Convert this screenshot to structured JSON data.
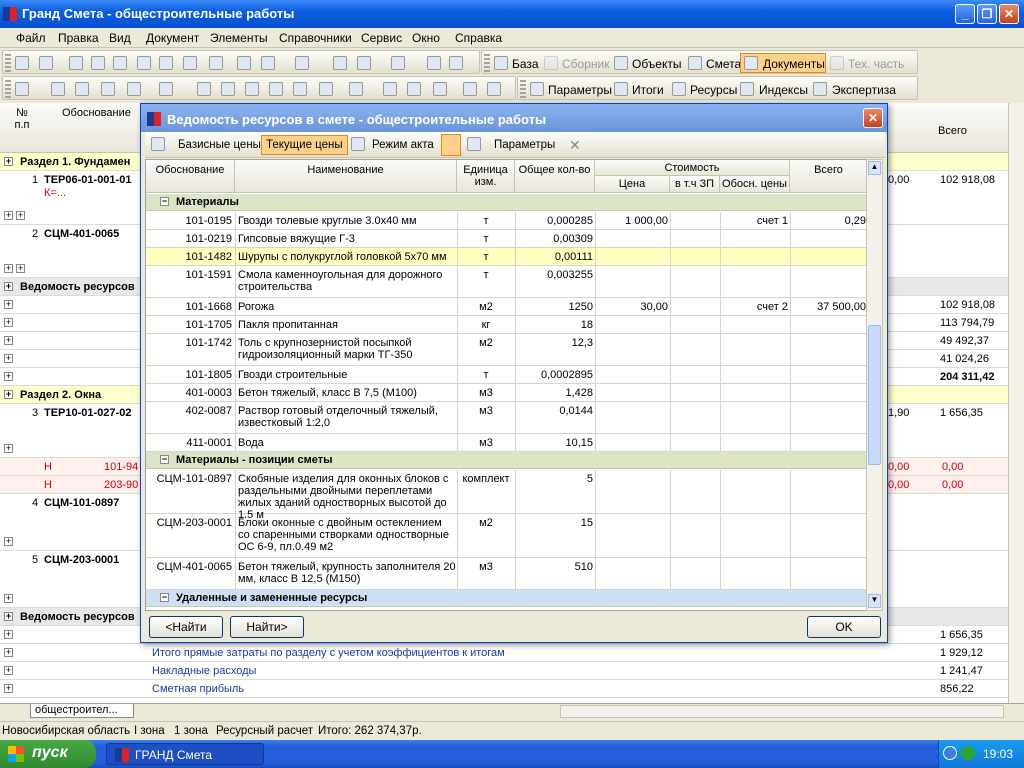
{
  "window": {
    "title": "Гранд Смета - общестроительные работы"
  },
  "menu": [
    "Файл",
    "Правка",
    "Вид",
    "Документ",
    "Элементы",
    "Справочники",
    "Сервис",
    "Окно",
    "Справка"
  ],
  "toolbar1": {
    "items": [
      "База",
      "Сборник",
      "Объекты",
      "Смета",
      "Документы",
      "Тех. часть"
    ]
  },
  "toolbar2": {
    "items": [
      "Параметры",
      "Итоги",
      "Ресурсы",
      "Индексы",
      "Экспертиза"
    ]
  },
  "main": {
    "headers": {
      "num": "№ п.п",
      "basis": "Обоснование",
      "total": "Всего"
    },
    "rows": [
      {
        "kind": "sec",
        "a": "Раздел 1. Фундамен"
      },
      {
        "kind": "item",
        "num": "1",
        "code": "ТЕР06-01-001-01",
        "sub": "К=...",
        "r1": "0,00",
        "total": "102 918,08"
      },
      {
        "kind": "item",
        "num": "2",
        "code": "СЦМ-401-0065"
      },
      {
        "kind": "grey",
        "a": "Ведомость ресурсов"
      },
      {
        "kind": "sum",
        "total": "102 918,08"
      },
      {
        "kind": "sum",
        "total": "113 794,79"
      },
      {
        "kind": "sum",
        "total": "49 492,37"
      },
      {
        "kind": "sum",
        "total": "41 024,26"
      },
      {
        "kind": "sum",
        "total": "204 311,42"
      },
      {
        "kind": "sec",
        "a": "Раздел 2. Окна"
      },
      {
        "kind": "item",
        "num": "3",
        "code": "ТЕР10-01-027-02",
        "r1": "1,90",
        "total": "1 656,35"
      },
      {
        "kind": "h",
        "code": "Н",
        "c2": "101-94",
        "r1": "0,00",
        "total": "0,00"
      },
      {
        "kind": "h",
        "code": "Н",
        "c2": "203-90",
        "r1": "0,00",
        "total": "0,00"
      },
      {
        "kind": "item",
        "num": "4",
        "code": "СЦМ-101-0897"
      },
      {
        "kind": "item",
        "num": "5",
        "code": "СЦМ-203-0001"
      },
      {
        "kind": "grey",
        "a": "Ведомость ресурсов"
      },
      {
        "kind": "sum",
        "total": "1 656,35"
      },
      {
        "kind": "lab",
        "a": "Итого прямые затраты по разделу с учетом коэффициентов к итогам",
        "total": "1 929,12"
      },
      {
        "kind": "lab",
        "a": "Накладные расходы",
        "total": "1 241,47"
      },
      {
        "kind": "lab",
        "a": "Сметная прибыль",
        "total": "856,22"
      }
    ]
  },
  "dialog": {
    "title": "Ведомость ресурсов в смете - общестроительные работы",
    "tb": {
      "base": "Базисные цены",
      "current": "Текущие цены",
      "act": "Режим акта",
      "params": "Параметры"
    },
    "cols": {
      "basis": "Обоснование",
      "name": "Наименование",
      "unit": "Единица изм.",
      "qty": "Общее кол-во",
      "cost": "Стоимость",
      "price": "Цена",
      "zp": "в т.ч ЗП",
      "src": "Обосн. цены",
      "total": "Всего"
    },
    "group1": "Материалы",
    "rows1": [
      {
        "code": "101-0195",
        "name": "Гвозди толевые круглые 3.0х40 мм",
        "unit": "т",
        "qty": "0,000285",
        "price": "1 000,00",
        "src": "счет 1",
        "total": "0,29"
      },
      {
        "code": "101-0219",
        "name": "Гипсовые вяжущие Г-3",
        "unit": "т",
        "qty": "0,00309"
      },
      {
        "code": "101-1482",
        "name": "Шурупы с полукруглой головкой 5х70 мм",
        "unit": "т",
        "qty": "0,00111",
        "sel": true
      },
      {
        "code": "101-1591",
        "name": "Смола каменноугольная для дорожного строительства",
        "unit": "т",
        "qty": "0,003255"
      },
      {
        "code": "101-1668",
        "name": "Рогожа",
        "unit": "м2",
        "qty": "1250",
        "price": "30,00",
        "src": "счет 2",
        "total": "37 500,00"
      },
      {
        "code": "101-1705",
        "name": "Пакля пропитанная",
        "unit": "кг",
        "qty": "18"
      },
      {
        "code": "101-1742",
        "name": "Толь с крупнозернистой посыпкой гидроизоляционный марки ТГ-350",
        "unit": "м2",
        "qty": "12,3"
      },
      {
        "code": "101-1805",
        "name": "Гвозди строительные",
        "unit": "т",
        "qty": "0,0002895"
      },
      {
        "code": "401-0003",
        "name": "Бетон тяжелый, класс В 7,5 (М100)",
        "unit": "м3",
        "qty": "1,428"
      },
      {
        "code": "402-0087",
        "name": "Раствор готовый отделочный тяжелый, известковый 1:2,0",
        "unit": "м3",
        "qty": "0,0144"
      },
      {
        "code": "411-0001",
        "name": "Вода",
        "unit": "м3",
        "qty": "10,15"
      }
    ],
    "group2": "Материалы - позиции сметы",
    "rows2": [
      {
        "code": "СЦМ-101-0897",
        "name": "Скобяные изделия для оконных блоков с раздельными двойными переплетами жилых зданий одностворных высотой до 1.5 м",
        "unit": "комплект",
        "qty": "5"
      },
      {
        "code": "СЦМ-203-0001",
        "name": "Блоки оконные с двойным остеклением со спаренными створками одностворные ОС 6-9, пл.0.49 м2",
        "unit": "м2",
        "qty": "15"
      },
      {
        "code": "СЦМ-401-0065",
        "name": "Бетон тяжелый, крупность заполнителя 20 мм, класс В 12,5 (М150)",
        "unit": "м3",
        "qty": "510"
      }
    ],
    "group3": "Удаленные и замененные ресурсы",
    "buttons": {
      "prev": "<Найти",
      "next": "Найти>",
      "ok": "OK"
    }
  },
  "tab": "общестроител...",
  "status": [
    "Новосибирская область",
    "I зона",
    "1 зона",
    "Ресурсный расчет",
    "Итого: 262 374,37р."
  ],
  "taskbar": {
    "start": "пуск",
    "app": "ГРАНД Смета",
    "time": "19:03"
  }
}
